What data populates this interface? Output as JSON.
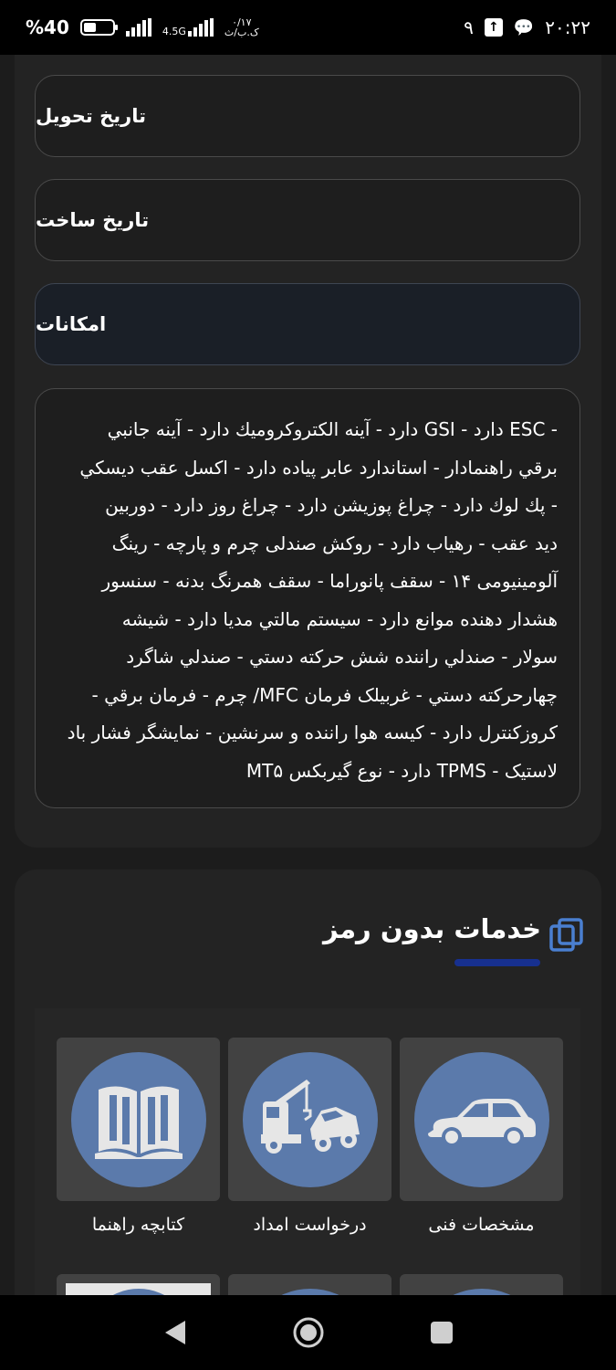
{
  "status_bar": {
    "battery_percent": "%40",
    "battery_level": 0.4,
    "network_type": "4.5G",
    "data_rate": "۰/۱۷",
    "data_rate_unit": "ک.ب/ث",
    "notification_count": "۹",
    "time": "۲۰:۲۲"
  },
  "fields": {
    "delivery_date_label": "تاريخ تحويل",
    "build_date_label": "تاريخ ساخت",
    "features_label": "امکانات"
  },
  "features_text": [
    "- ESC دارد - GSI دارد - آينه الكتروكروميك دارد - آينه جانبي",
    "برقي راهنمادار - استاندارد عابر پياده دارد - اكسل عقب ديسكي",
    "- پك لوك دارد - چراغ پوزيشن دارد - چراغ روز دارد - دوربين",
    "ديد عقب - رهياب دارد - روكش صندلی چرم و پارچه - رينگ",
    "آلومينيومی ۱۴ - سقف پانوراما - سقف همرنگ بدنه - سنسور",
    "هشدار دهنده موانع دارد - سيستم مالتي مديا دارد - شيشه",
    "سولار - صندلي راننده شش حركته دستي - صندلي شاگرد",
    "چهارحركته دستي - غربيلک فرمان MFC/ چرم - فرمان برقي -",
    "كروزكنترل دارد - كيسه هوا راننده و سرنشين - نمايشگر فشار باد",
    "لاستيک - TPMS دارد - نوع گيربكس MT۵"
  ],
  "services": {
    "title": "خدمات بدون رمز",
    "accent_color": "#17308f",
    "icon_circle_color": "#5b7aab",
    "items": [
      {
        "label": "مشخصات فنی",
        "icon": "car-icon"
      },
      {
        "label": "درخواست امداد",
        "icon": "tow-truck-icon"
      },
      {
        "label": "کتابچه راهنما",
        "icon": "book-icon"
      }
    ]
  },
  "nav_bar": {
    "back": "back-icon",
    "home": "home-icon",
    "recents": "recents-icon"
  }
}
